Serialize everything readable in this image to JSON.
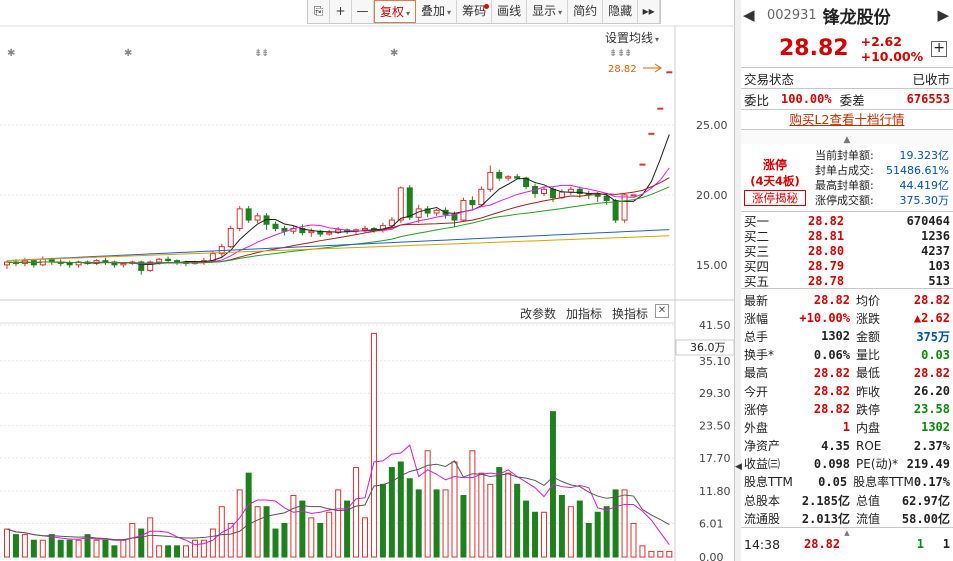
{
  "toolbar": {
    "items": [
      {
        "name": "lock-icon",
        "label": "⎘",
        "icon": true
      },
      {
        "name": "zoom-in-button",
        "label": "+",
        "icon": true
      },
      {
        "name": "zoom-out-button",
        "label": "—",
        "icon": true
      },
      {
        "name": "adjust-rights-button",
        "label": "复权",
        "caret": true,
        "active": true
      },
      {
        "name": "overlay-button",
        "label": "叠加",
        "caret": true
      },
      {
        "name": "chips-button",
        "label": "筹码",
        "dot": true
      },
      {
        "name": "draw-line-button",
        "label": "画线"
      },
      {
        "name": "display-button",
        "label": "显示",
        "caret": true
      },
      {
        "name": "simple-button",
        "label": "简约"
      },
      {
        "name": "hide-button",
        "label": "隐藏"
      },
      {
        "name": "expand-button",
        "label": "▸▸",
        "icon": true
      }
    ]
  },
  "price_panel": {
    "ma_setting": "设置均线",
    "current_price_tag": "28.82",
    "y_ticks": [
      "25.00",
      "20.00",
      "15.00"
    ]
  },
  "volume_panel": {
    "buttons": [
      "改参数",
      "加指标",
      "换指标"
    ],
    "y_ticks": [
      "41.50",
      "35.10",
      "29.30",
      "23.50",
      "17.70",
      "11.80",
      "6.01",
      "0.00"
    ],
    "current_label": "36.0万"
  },
  "chart_data": {
    "type": "candlestick",
    "title": "",
    "ylim": [
      13.2,
      29.5
    ],
    "candles": [
      [
        15.0,
        15.2,
        14.7,
        15.3
      ],
      [
        15.2,
        15.1,
        14.9,
        15.4
      ],
      [
        15.1,
        15.3,
        14.9,
        15.5
      ],
      [
        15.3,
        15.0,
        14.8,
        15.4
      ],
      [
        15.0,
        15.4,
        14.9,
        15.6
      ],
      [
        15.4,
        15.2,
        15.0,
        15.5
      ],
      [
        15.2,
        15.1,
        14.9,
        15.4
      ],
      [
        15.1,
        15.0,
        14.8,
        15.3
      ],
      [
        15.0,
        15.2,
        14.8,
        15.3
      ],
      [
        15.2,
        15.1,
        15.0,
        15.3
      ],
      [
        15.1,
        15.3,
        15.0,
        15.4
      ],
      [
        15.3,
        15.2,
        15.0,
        15.5
      ],
      [
        15.2,
        15.0,
        14.8,
        15.3
      ],
      [
        15.0,
        15.1,
        14.8,
        15.2
      ],
      [
        15.1,
        15.2,
        15.0,
        15.3
      ],
      [
        15.2,
        14.6,
        14.3,
        15.3
      ],
      [
        14.6,
        15.2,
        14.5,
        15.3
      ],
      [
        15.2,
        15.4,
        15.0,
        15.5
      ],
      [
        15.4,
        15.3,
        15.1,
        15.6
      ],
      [
        15.3,
        15.2,
        15.0,
        15.4
      ],
      [
        15.2,
        15.1,
        14.9,
        15.3
      ],
      [
        15.1,
        15.2,
        15.0,
        15.3
      ],
      [
        15.2,
        15.3,
        15.0,
        15.5
      ],
      [
        15.3,
        15.8,
        15.2,
        16.0
      ],
      [
        15.8,
        16.3,
        15.6,
        16.5
      ],
      [
        16.3,
        17.6,
        16.2,
        17.8
      ],
      [
        17.6,
        19.0,
        17.4,
        19.2
      ],
      [
        19.0,
        18.2,
        18.0,
        19.2
      ],
      [
        18.2,
        18.5,
        18.0,
        18.7
      ],
      [
        18.5,
        17.9,
        17.5,
        18.7
      ],
      [
        17.9,
        17.6,
        17.4,
        18.1
      ],
      [
        17.6,
        17.4,
        17.1,
        17.8
      ],
      [
        17.4,
        17.6,
        17.2,
        17.8
      ],
      [
        17.6,
        17.3,
        17.1,
        17.9
      ],
      [
        17.3,
        17.4,
        17.0,
        17.6
      ],
      [
        17.4,
        17.2,
        17.0,
        17.5
      ],
      [
        17.2,
        17.3,
        17.1,
        17.5
      ],
      [
        17.3,
        17.5,
        17.2,
        17.7
      ],
      [
        17.5,
        17.4,
        17.2,
        17.6
      ],
      [
        17.4,
        17.5,
        17.2,
        17.6
      ],
      [
        17.5,
        17.6,
        17.3,
        17.8
      ],
      [
        17.6,
        17.5,
        17.3,
        17.7
      ],
      [
        17.5,
        17.8,
        17.3,
        18.0
      ],
      [
        17.8,
        18.2,
        17.6,
        18.4
      ],
      [
        18.2,
        20.5,
        18.0,
        20.6
      ],
      [
        20.5,
        18.4,
        18.2,
        20.7
      ],
      [
        18.4,
        19.0,
        18.0,
        19.3
      ],
      [
        19.0,
        18.7,
        18.4,
        19.2
      ],
      [
        18.7,
        18.9,
        18.5,
        19.0
      ],
      [
        18.9,
        18.6,
        18.3,
        19.1
      ],
      [
        18.6,
        18.2,
        17.7,
        18.8
      ],
      [
        18.2,
        19.6,
        18.1,
        19.8
      ],
      [
        19.6,
        19.3,
        19.0,
        19.9
      ],
      [
        19.3,
        20.4,
        19.2,
        20.6
      ],
      [
        20.4,
        21.6,
        20.2,
        22.1
      ],
      [
        21.6,
        21.2,
        21.0,
        21.8
      ],
      [
        21.2,
        21.3,
        21.0,
        21.4
      ],
      [
        21.3,
        21.2,
        21.1,
        21.5
      ],
      [
        21.2,
        20.6,
        20.4,
        21.3
      ],
      [
        20.6,
        20.1,
        19.8,
        20.8
      ],
      [
        20.1,
        20.4,
        19.9,
        20.6
      ],
      [
        20.4,
        19.8,
        19.5,
        20.6
      ],
      [
        19.8,
        20.2,
        19.7,
        20.4
      ],
      [
        20.2,
        20.4,
        20.0,
        20.6
      ],
      [
        20.4,
        20.1,
        19.8,
        20.6
      ],
      [
        20.1,
        20.0,
        19.7,
        20.3
      ],
      [
        20.0,
        19.9,
        19.5,
        20.2
      ],
      [
        19.9,
        19.6,
        19.3,
        20.1
      ],
      [
        19.6,
        18.2,
        18.0,
        19.7
      ],
      [
        18.2,
        20.0,
        18.0,
        20.1
      ],
      [
        20.0,
        20.0,
        20.0,
        20.0
      ],
      [
        22.2,
        22.2,
        22.2,
        22.2
      ],
      [
        24.4,
        24.4,
        24.4,
        24.4
      ],
      [
        26.2,
        26.2,
        26.2,
        26.2
      ],
      [
        28.8,
        28.8,
        28.8,
        28.8
      ]
    ],
    "volume": [
      5,
      4,
      4,
      3,
      3,
      4,
      3,
      3,
      3,
      4,
      3,
      3,
      2,
      3,
      6,
      5,
      7,
      2,
      2,
      2,
      2,
      3,
      3,
      5,
      9,
      6,
      12,
      15,
      9,
      9,
      5,
      6,
      11,
      10,
      7,
      6,
      8,
      12,
      10,
      16,
      7,
      40,
      13,
      16,
      17,
      14,
      12,
      19,
      12,
      12,
      17,
      11,
      19,
      15,
      13,
      16,
      15,
      13,
      10,
      8,
      8,
      26,
      11,
      9,
      10,
      6,
      8,
      9,
      12,
      12,
      6,
      2,
      1,
      1,
      1
    ],
    "volume_up": [
      true,
      false,
      true,
      false,
      true,
      false,
      false,
      false,
      true,
      false,
      true,
      false,
      false,
      true,
      true,
      false,
      true,
      true,
      false,
      false,
      true,
      true,
      true,
      true,
      true,
      true,
      true,
      false,
      true,
      false,
      false,
      false,
      true,
      false,
      true,
      false,
      true,
      true,
      false,
      true,
      true,
      true,
      false,
      false,
      false,
      false,
      false,
      true,
      false,
      true,
      true,
      false,
      true,
      true,
      true,
      false,
      true,
      false,
      false,
      false,
      true,
      false,
      false,
      true,
      false,
      false,
      false,
      false,
      false,
      true,
      true,
      true,
      true,
      true,
      true
    ]
  },
  "quote": {
    "code": "002931",
    "name": "锋龙股份",
    "price": "28.82",
    "change": "+2.62",
    "change_pct": "+10.00%",
    "status_label": "交易状态",
    "status_value": "已收市",
    "wb_label": "委比",
    "wb_value": "100.00%",
    "wc_label": "委差",
    "wc_value": "676553",
    "l2_link": "购买L2查看十档行情",
    "limit": {
      "tag": "涨停",
      "streak": "(4天4板)",
      "secret": "涨停揭秘",
      "rows": [
        [
          "当前封单额:",
          "19.323亿"
        ],
        [
          "封单占成交:",
          "51486.61%"
        ],
        [
          "最高封单额:",
          "44.419亿"
        ],
        [
          "涨停成交额:",
          "375.30万"
        ]
      ]
    },
    "bids": [
      [
        "买一",
        "28.82",
        "670464"
      ],
      [
        "买二",
        "28.81",
        "1236"
      ],
      [
        "买三",
        "28.80",
        "4237"
      ],
      [
        "买四",
        "28.79",
        "103"
      ],
      [
        "买五",
        "28.78",
        "513"
      ]
    ],
    "stats": [
      [
        "最新",
        "28.82",
        "red",
        "均价",
        "28.82",
        "red"
      ],
      [
        "涨幅",
        "+10.00%",
        "red",
        "涨跌",
        "▲2.62",
        "red"
      ],
      [
        "总手",
        "1302",
        "",
        "金额",
        "375万",
        "blue"
      ],
      [
        "换手*",
        "0.06%",
        "",
        "量比",
        "0.03",
        "green"
      ],
      [
        "最高",
        "28.82",
        "red",
        "最低",
        "28.82",
        "red"
      ],
      [
        "今开",
        "28.82",
        "red",
        "昨收",
        "26.20",
        ""
      ],
      [
        "涨停",
        "28.82",
        "red",
        "跌停",
        "23.58",
        "green"
      ],
      [
        "外盘",
        "1",
        "red",
        "内盘",
        "1302",
        "green"
      ],
      [
        "净资产",
        "4.35",
        "",
        "ROE",
        "2.37%",
        ""
      ],
      [
        "收益㈢",
        "0.098",
        "",
        "PE(动)*",
        "219.49",
        ""
      ],
      [
        "股息TTM",
        "0.05",
        "",
        "股息率TTM",
        "0.17%",
        ""
      ],
      [
        "总股本",
        "2.185亿",
        "",
        "总值",
        "62.97亿",
        ""
      ],
      [
        "流通股",
        "2.013亿",
        "",
        "流值",
        "58.00亿",
        ""
      ]
    ],
    "tick": {
      "time": "14:38",
      "price": "28.82",
      "vol": "1",
      "num": "1"
    }
  }
}
